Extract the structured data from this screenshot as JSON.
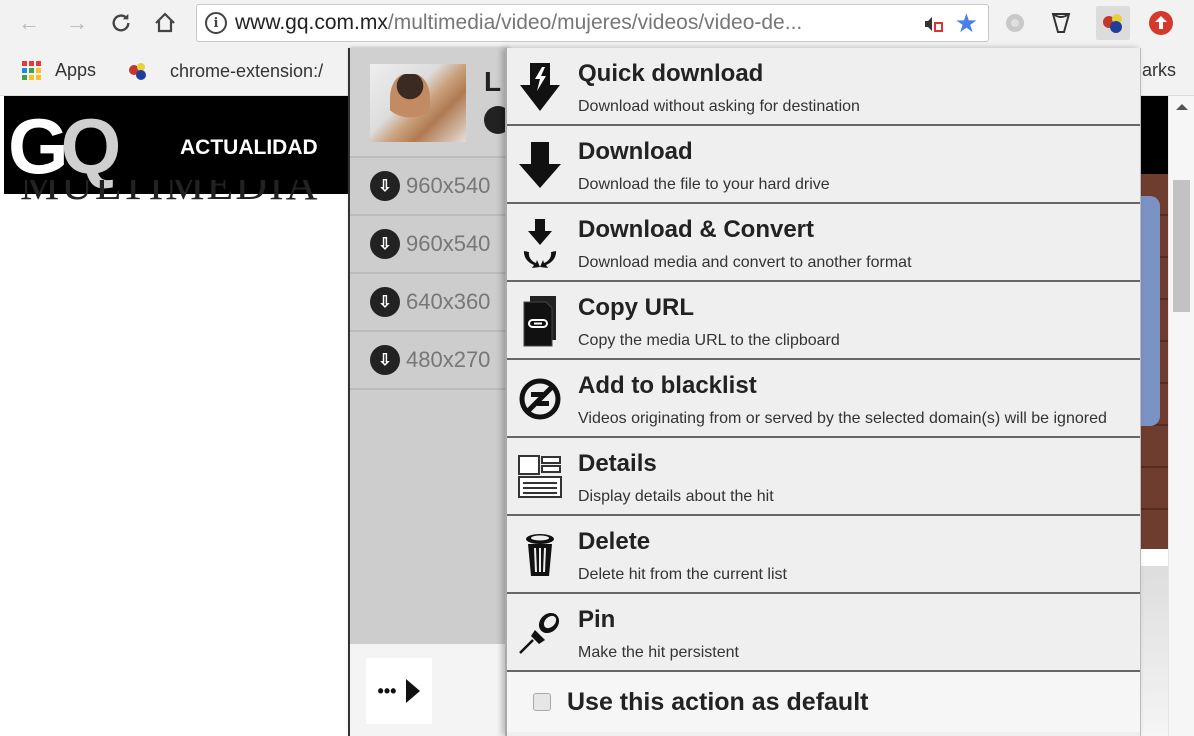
{
  "browser": {
    "url_host": "www.gq.com.mx",
    "url_path": "/multimedia/video/mujeres/videos/video-de...",
    "bookmarks": [
      {
        "label": "Apps",
        "icon": "apps-grid-icon"
      },
      {
        "label": "chrome-extension:/",
        "icon": "video-downloader-icon"
      }
    ],
    "bookmarks_overflow": "arks",
    "extensions": [
      "puzzle-extension-icon",
      "funnel-extension-icon",
      "video-downloadhelper-icon",
      "upload-extension-icon"
    ]
  },
  "page": {
    "nav_item": "ACTUALIDAD",
    "section_title": "MULTIMEDIA",
    "logo_g": "G",
    "logo_q": "Q"
  },
  "hits": {
    "title_initial": "L",
    "variants": [
      {
        "resolution": "960x540"
      },
      {
        "resolution": "960x540"
      },
      {
        "resolution": "640x360"
      },
      {
        "resolution": "480x270"
      }
    ],
    "more_label": "•••"
  },
  "actions": [
    {
      "title": "Quick download",
      "desc": "Download without asking for destination",
      "icon": "quick-download-icon"
    },
    {
      "title": "Download",
      "desc": "Download the file to your hard drive",
      "icon": "download-icon"
    },
    {
      "title": "Download & Convert",
      "desc": "Download media and convert to another format",
      "icon": "download-convert-icon"
    },
    {
      "title": "Copy URL",
      "desc": "Copy the media URL to the clipboard",
      "icon": "copy-url-icon"
    },
    {
      "title": "Add to blacklist",
      "desc": "Videos originating from or served by the selected domain(s) will be ignored",
      "icon": "blacklist-icon"
    },
    {
      "title": "Details",
      "desc": "Display details about the hit",
      "icon": "details-icon"
    },
    {
      "title": "Delete",
      "desc": "Delete hit from the current list",
      "icon": "trash-icon"
    },
    {
      "title": "Pin",
      "desc": "Make the hit persistent",
      "icon": "pin-icon"
    }
  ],
  "default_action": {
    "label": "Use this action as default",
    "checked": false
  },
  "colors": {
    "star": "#4a7fe8",
    "upload_ext": "#d33a2c",
    "menu_bg": "#efefef",
    "panel_bg": "#cdcdcd"
  }
}
